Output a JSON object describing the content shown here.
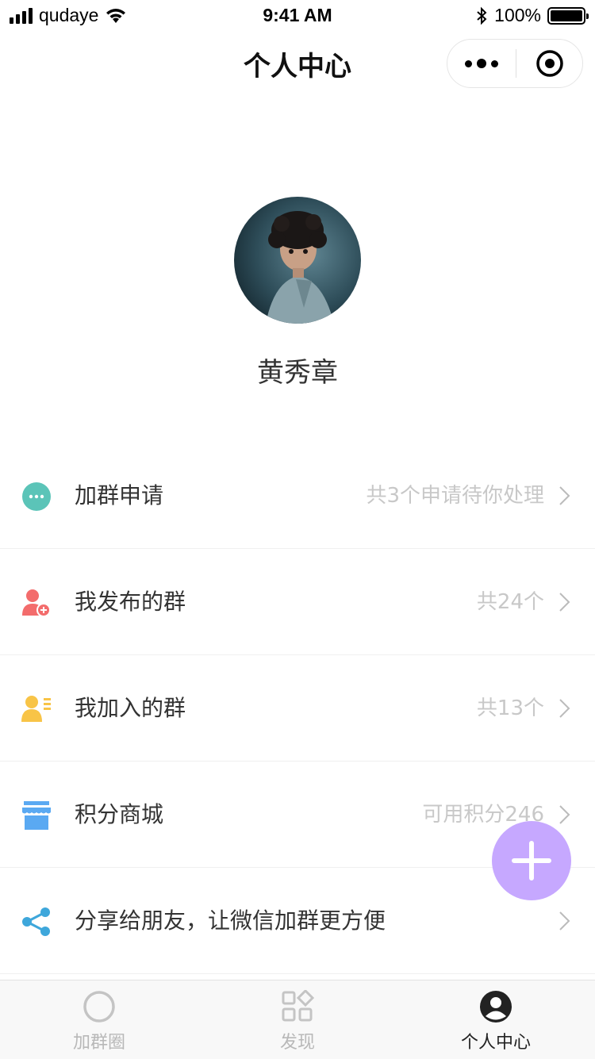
{
  "status_bar": {
    "carrier": "qudaye",
    "time": "9:41 AM",
    "battery": "100%"
  },
  "nav": {
    "title": "个人中心"
  },
  "profile": {
    "name": "黄秀章"
  },
  "menu": [
    {
      "label": "加群申请",
      "extra": "共3个申请待你处理",
      "icon": "chat-bubble-icon",
      "color": "#5bc4b8"
    },
    {
      "label": "我发布的群",
      "extra": "共24个",
      "icon": "user-add-icon",
      "color": "#f36c6c"
    },
    {
      "label": "我加入的群",
      "extra": "共13个",
      "icon": "user-card-icon",
      "color": "#f8c447"
    },
    {
      "label": "积分商城",
      "extra": "可用积分246",
      "icon": "store-icon",
      "color": "#5aa9f2"
    },
    {
      "label": "分享给朋友，让微信加群更方便",
      "extra": "",
      "icon": "share-icon",
      "color": "#3ea7db"
    }
  ],
  "fab": {
    "icon": "plus-icon",
    "color": "#c6a8ff"
  },
  "tabs": [
    {
      "label": "加群圈",
      "icon": "circle-icon",
      "active": false
    },
    {
      "label": "发现",
      "icon": "discover-grid-icon",
      "active": false
    },
    {
      "label": "个人中心",
      "icon": "profile-icon",
      "active": true
    }
  ]
}
